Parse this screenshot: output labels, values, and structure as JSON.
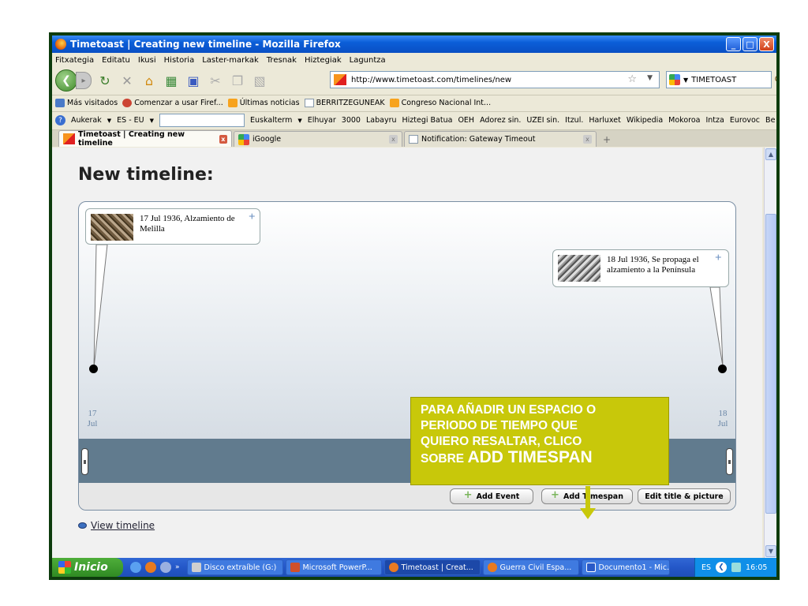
{
  "window": {
    "title": "Timetoast | Creating new timeline - Mozilla Firefox",
    "buttons": [
      "_",
      "□",
      "X"
    ]
  },
  "menu": [
    "Fitxategia",
    "Editatu",
    "Ikusi",
    "Historia",
    "Laster-markak",
    "Tresnak",
    "Hiztegiak",
    "Laguntza"
  ],
  "nav": {
    "url": "http://www.timetoast.com/timelines/new",
    "search_value": "TIMETOAST"
  },
  "bookmarks": [
    {
      "label": "Más visitados",
      "icon": "most-visited-icon"
    },
    {
      "label": "Comenzar a usar Firef...",
      "icon": "firefox-icon"
    },
    {
      "label": "Últimas noticias",
      "icon": "rss-icon"
    },
    {
      "label": "BERRITZEGUNEAK",
      "icon": "page-icon"
    },
    {
      "label": "Congreso Nacional Int...",
      "icon": "rss-icon"
    }
  ],
  "toolbar2": {
    "items": [
      "Aukerak",
      "ES - EU",
      "Euskalterm",
      "Elhuyar",
      "3000",
      "Labayru",
      "Hiztegi Batua",
      "OEH",
      "Adorez sin.",
      "UZEI sin.",
      "Itzul.",
      "Harluxet",
      "Wikipedia",
      "Mokoroa",
      "Intza",
      "Eurovoc",
      "Be"
    ]
  },
  "tabs": [
    {
      "label": "Timetoast | Creating new timeline",
      "active": true
    },
    {
      "label": "iGoogle",
      "active": false
    },
    {
      "label": "Notification: Gateway Timeout",
      "active": false
    }
  ],
  "page": {
    "title": "New timeline:",
    "events": [
      {
        "text": "17 Jul 1936, Alzamiento de Melilla"
      },
      {
        "text": "18 Jul 1936, Se propaga el alzamiento a la Península"
      }
    ],
    "ticks": [
      {
        "day": "17",
        "month": "Jul"
      },
      {
        "day": "18",
        "month": "Jul"
      }
    ],
    "buttons": {
      "add_event": "Add Event",
      "add_timespan": "Add Timespan",
      "edit_title": "Edit title & picture"
    },
    "view_link": "View timeline"
  },
  "callout": {
    "line1": "PARA AÑADIR UN ESPACIO O",
    "line2": "PERIODO DE TIEMPO QUE",
    "line3": "QUIERO RESALTAR, CLICO",
    "line4_small": "SOBRE",
    "line4_big": "ADD TIMESPAN"
  },
  "taskbar": {
    "start": "Inicio",
    "tasks": [
      {
        "label": "Disco extraíble (G:)",
        "active": false
      },
      {
        "label": "Microsoft PowerP...",
        "active": false
      },
      {
        "label": "Timetoast | Creat...",
        "active": true
      },
      {
        "label": "Guerra Civil Espa...",
        "active": false
      },
      {
        "label": "Documento1 - Mic...",
        "active": false
      }
    ],
    "lang": "ES",
    "time": "16:05"
  }
}
